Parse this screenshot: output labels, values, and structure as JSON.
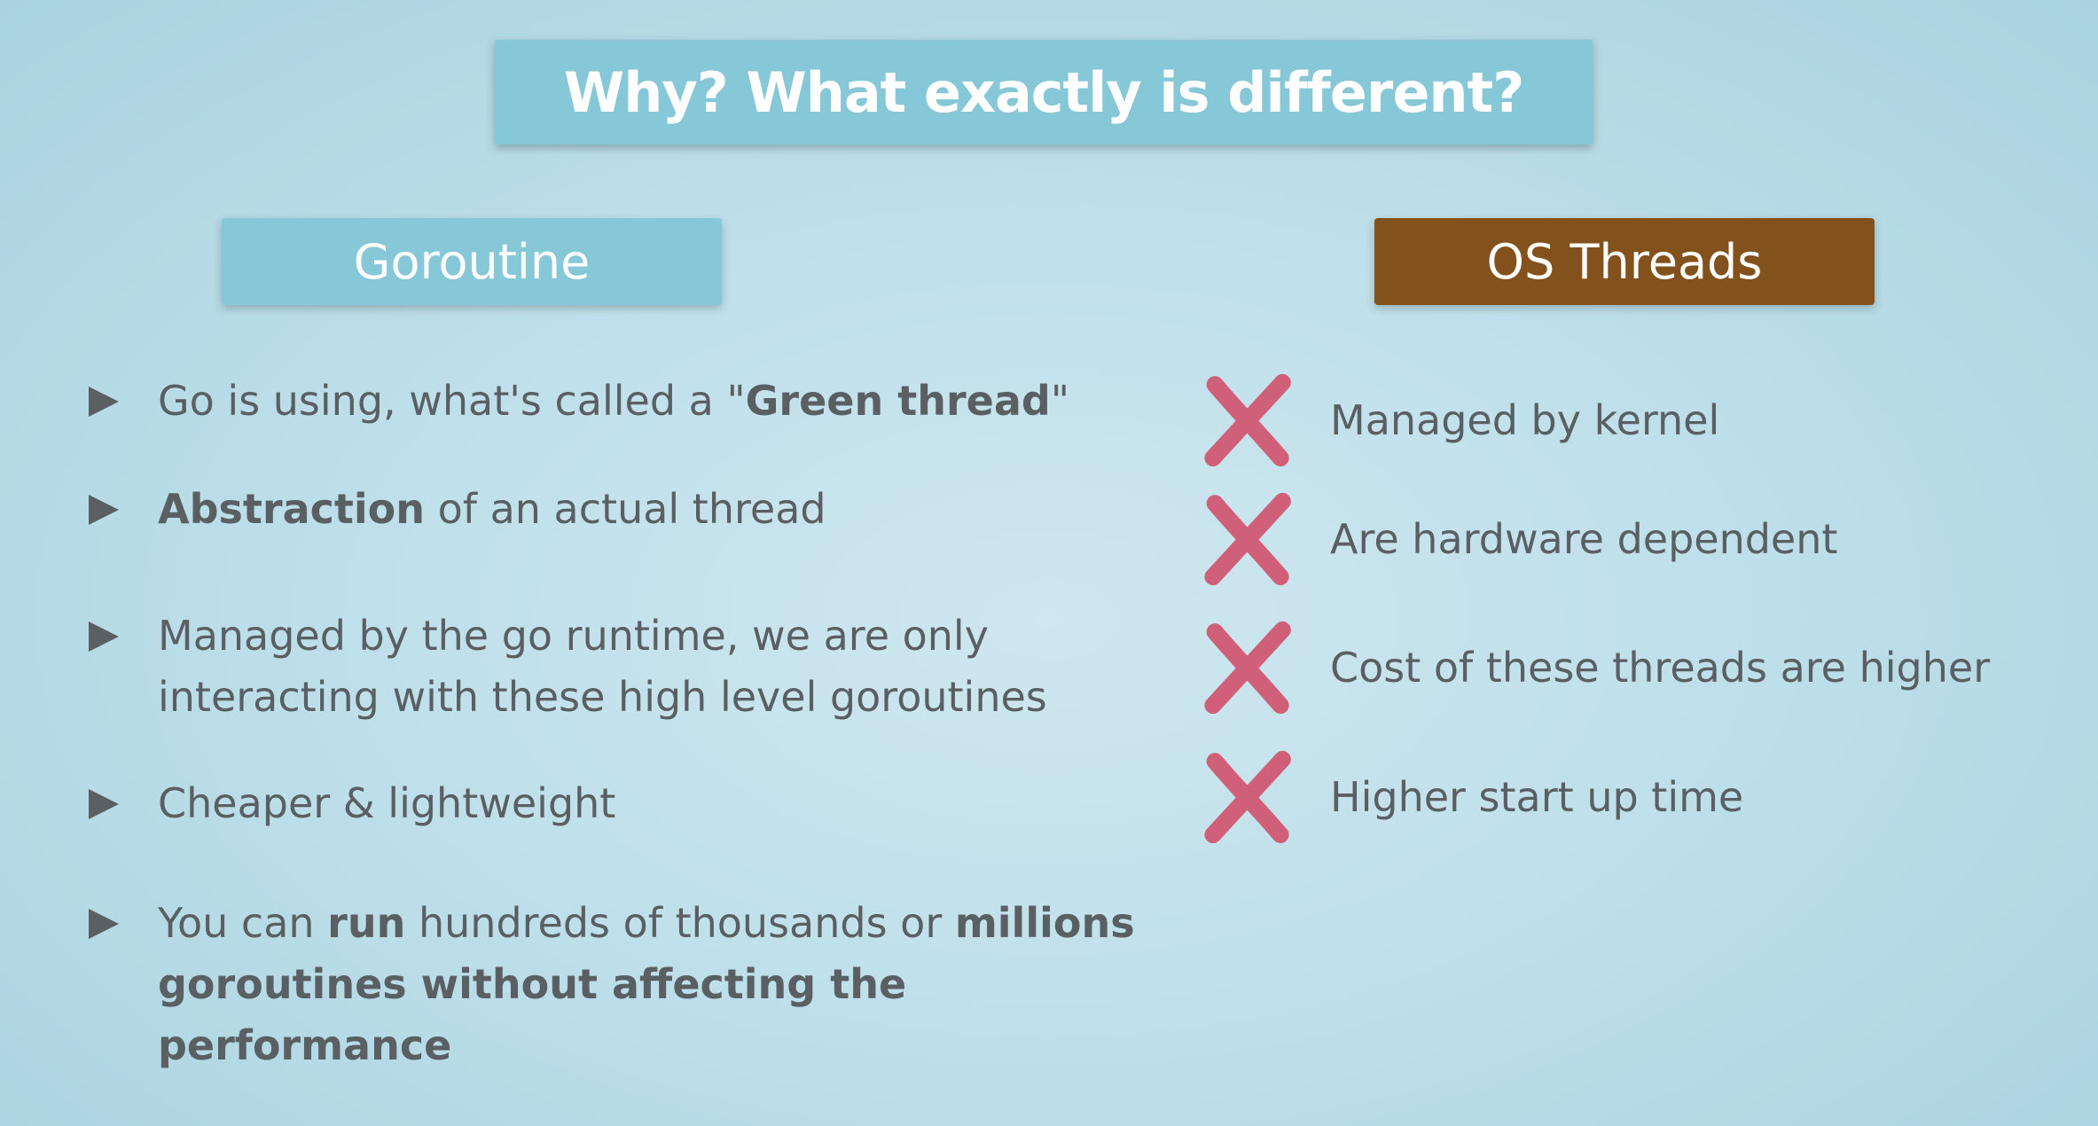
{
  "title": "Why? What exactly is different?",
  "left": {
    "header": "Goroutine",
    "bullets": [
      {
        "pre": "Go is using, what's called a \"",
        "bold": "Green thread",
        "post": "\""
      },
      {
        "bold": "Abstraction",
        "post": " of an actual thread"
      },
      {
        "line1": "Managed by the go runtime, we are only",
        "line2": "interacting with these high level goroutines"
      },
      {
        "text": "Cheaper & lightweight"
      },
      {
        "pre": "You can ",
        "bold1": "run",
        "mid": " hundreds of thousands or ",
        "bold2": "millions",
        "line2": "goroutines without affecting the performance"
      }
    ]
  },
  "right": {
    "header": "OS Threads",
    "items": [
      "Managed by kernel",
      "Are hardware dependent",
      "Cost of these threads are higher",
      "Higher start up time"
    ]
  },
  "colors": {
    "title_bg": "#86c8d8",
    "goroutine_bg": "#86c8d8",
    "os_bg": "#83521c",
    "x_mark": "#d0607a",
    "text": "#5a5f63"
  }
}
